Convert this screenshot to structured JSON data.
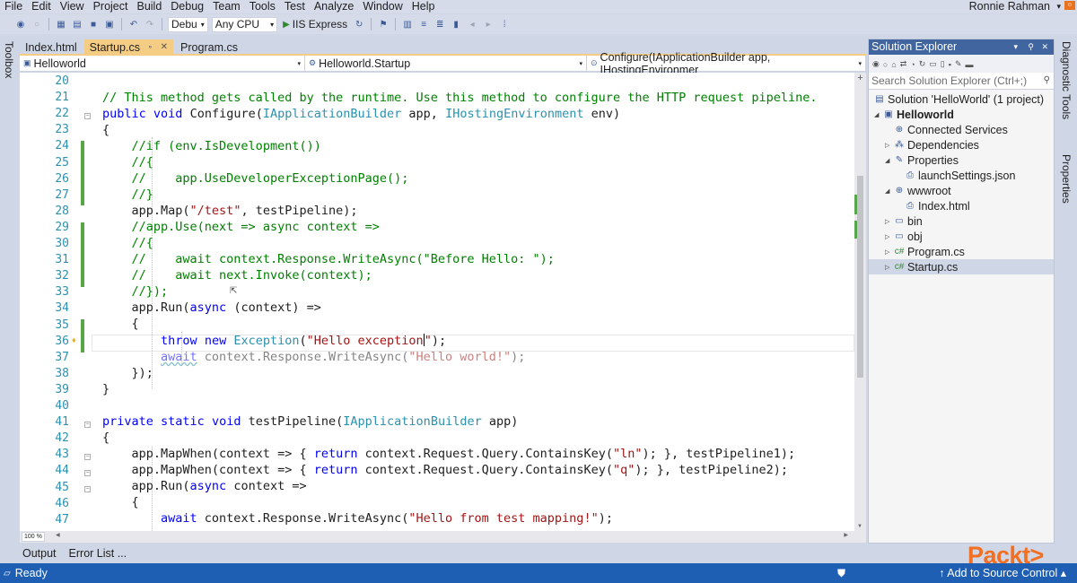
{
  "menu": [
    "File",
    "Edit",
    "View",
    "Project",
    "Build",
    "Debug",
    "Team",
    "Tools",
    "Test",
    "Analyze",
    "Window",
    "Help"
  ],
  "user": "Ronnie Rahman",
  "toolbar": {
    "config": "Debu",
    "platform": "Any CPU",
    "run_label": "IIS Express"
  },
  "left_strip_label": "Toolbox",
  "right_strip_labels": [
    "Diagnostic Tools",
    "Properties"
  ],
  "tabs": [
    {
      "label": "Index.html",
      "active": false
    },
    {
      "label": "Startup.cs",
      "active": true
    },
    {
      "label": "Program.cs",
      "active": false
    }
  ],
  "navbar": {
    "project": "Helloworld",
    "class": "Helloworld.Startup",
    "member": "Configure(IApplicationBuilder app, IHostingEnvironmer"
  },
  "editor": {
    "line_numbers": [
      "20",
      "21",
      "22",
      "23",
      "24",
      "25",
      "26",
      "27",
      "28",
      "29",
      "30",
      "31",
      "32",
      "33",
      "34",
      "35",
      "36",
      "37",
      "38",
      "39",
      "40",
      "41",
      "42",
      "43",
      "44",
      "45",
      "46",
      "47"
    ]
  },
  "bottom": {
    "zoom": "100 %",
    "output_tab": "Output",
    "errorlist_tab": "Error List ..."
  },
  "solution_explorer": {
    "title": "Solution Explorer",
    "search_placeholder": "Search Solution Explorer (Ctrl+;)",
    "items": [
      {
        "label": "Solution 'HelloWorld' (1 project)",
        "icon": "solution-icon"
      },
      {
        "label": "Helloworld",
        "icon": "project-icon"
      },
      {
        "label": "Connected Services",
        "icon": "connected-services-icon"
      },
      {
        "label": "Dependencies",
        "icon": "dependencies-icon"
      },
      {
        "label": "Properties",
        "icon": "wrench-icon"
      },
      {
        "label": "launchSettings.json",
        "icon": "json-file-icon"
      },
      {
        "label": "wwwroot",
        "icon": "globe-icon"
      },
      {
        "label": "Index.html",
        "icon": "html-file-icon"
      },
      {
        "label": "bin",
        "icon": "folder-icon"
      },
      {
        "label": "obj",
        "icon": "folder-icon"
      },
      {
        "label": "Program.cs",
        "icon": "csharp-file-icon"
      },
      {
        "label": "Startup.cs",
        "icon": "csharp-file-icon"
      }
    ]
  },
  "status": {
    "ready": "Ready",
    "source_control": "Add to Source Control"
  },
  "brand": "Packt>",
  "colors": {
    "status_bar": "#1e5fb4",
    "active_tab": "#f5cc84",
    "keyword": "#0000ff",
    "type": "#2b91af",
    "string": "#a31515",
    "comment": "#008000",
    "brand": "#f36f21"
  }
}
